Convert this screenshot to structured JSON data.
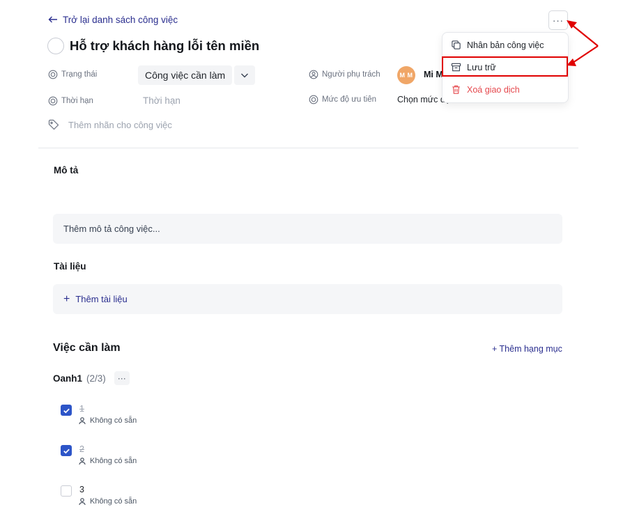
{
  "header": {
    "back_label": "Trở lại danh sách công việc",
    "title": "Hỗ trợ khách hàng lỗi tên miền",
    "more_label": "···"
  },
  "fields": {
    "status_label": "Trạng thái",
    "status_value": "Công việc cần làm",
    "deadline_label": "Thời hạn",
    "deadline_placeholder": "Thời hạn",
    "tag_placeholder": "Thêm nhãn cho công việc",
    "assignee_label": "Người phụ trách",
    "assignee_initials": "M M",
    "assignee_name": "Mi M",
    "priority_label": "Mức độ ưu tiên",
    "priority_value": "Chọn mức độ ưu tiên"
  },
  "description": {
    "heading": "Mô tả",
    "placeholder": "Thêm mô tả công việc..."
  },
  "documents": {
    "heading": "Tài liệu",
    "add_label": "Thêm tài liệu",
    "add_glyph": "+"
  },
  "todo": {
    "heading": "Việc cần làm",
    "add_category": "+ Thêm hạng mục",
    "group_name": "Oanh1",
    "group_count": "(2/3)",
    "group_more": "···",
    "items": [
      {
        "name": "1",
        "assignee": "Không có sẵn",
        "checked": true
      },
      {
        "name": "2",
        "assignee": "Không có sẵn",
        "checked": true
      },
      {
        "name": "3",
        "assignee": "Không có sẵn",
        "checked": false
      }
    ]
  },
  "menu": {
    "items": [
      {
        "label": "Nhân bản công việc",
        "icon": "copy-icon"
      },
      {
        "label": "Lưu trữ",
        "icon": "archive-icon"
      },
      {
        "label": "Xoá giao dịch",
        "icon": "trash-icon"
      }
    ]
  },
  "colors": {
    "accent": "#2b2f8f",
    "checkbox": "#2d55c8",
    "danger": "#e5484d",
    "annotation": "#e00000",
    "avatar": "#f0a667"
  }
}
